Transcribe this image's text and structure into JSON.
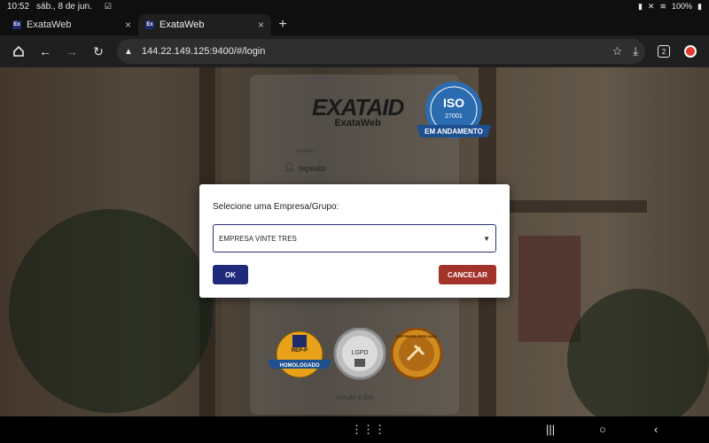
{
  "status": {
    "time": "10:52",
    "date": "sáb., 8 de jun.",
    "battery": "100%"
  },
  "tabs": [
    {
      "favicon": "Ex",
      "title": "ExataWeb",
      "close": "×"
    },
    {
      "favicon": "Ex",
      "title": "ExataWeb",
      "close": "×"
    }
  ],
  "new_tab": "+",
  "toolbar": {
    "url": "144.22.149.125:9400/#/login",
    "tab_count": "2"
  },
  "login": {
    "logo_word": "EXATAID",
    "logo_sub": "ExataWeb",
    "iso_text": "ISO",
    "iso_number": "27001",
    "iso_banner": "EM ANDAMENTO",
    "user_label": "Usuario *",
    "user_value": "repeato",
    "badge1_top": "REP-P",
    "badge1_banner": "HOMOLOGADO",
    "badge2_text": "LGPD",
    "badge3_text": "SOFTWARE PERICIADO",
    "version": "Versão 8.000"
  },
  "modal": {
    "title": "Selecione uma Empresa/Grupo:",
    "selected": "EMPRESA VINTE TRES",
    "ok_label": "OK",
    "cancel_label": "CANCELAR"
  },
  "colors": {
    "primary": "#1f2a7a",
    "danger": "#a3322b",
    "iso_blue": "#2b6cb0"
  }
}
